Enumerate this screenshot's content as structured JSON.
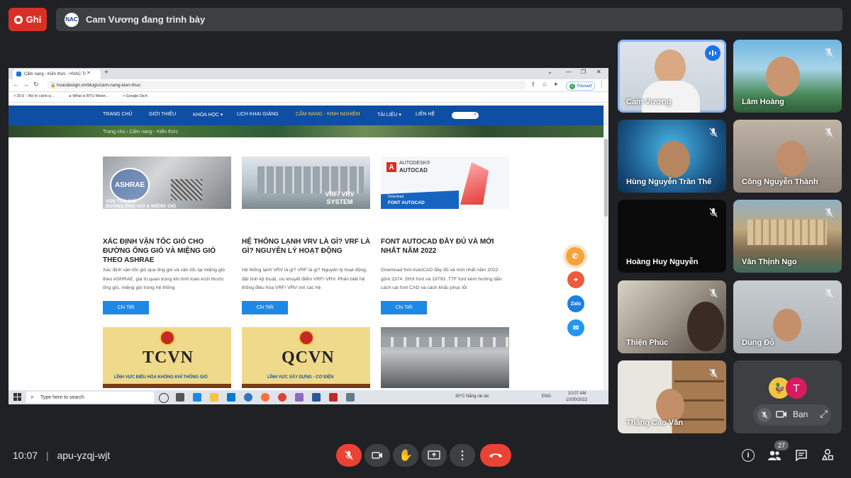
{
  "topbar": {
    "record_label": "Ghi",
    "presenter_logo": "NAC",
    "presenting_text": "Cam Vương đang trình bày"
  },
  "browser": {
    "tab_title": "Cẩm nang - Kiến thức - HVAC Tr",
    "url": "hvacdesign.vn/blogs/cam-nang-kien-thuc",
    "profile_initial": "C",
    "profile_status": "Paused",
    "bookmarks": [
      "20.6 – Bộ trì cảnh q...",
      "What is BTU Meter...",
      "Google Dịch"
    ]
  },
  "site": {
    "nav": [
      "TRANG CHỦ",
      "GIỚI THIỆU",
      "KHÓA HỌC ▾",
      "LỊCH KHAI GIẢNG",
      "CẨM NANG - KINH NGHIỆM",
      "TÀI LIỆU ▾",
      "LIÊN HỆ"
    ],
    "breadcrumb": "Trang chủ › Cẩm nang - Kiến thức",
    "cards": [
      {
        "img_logo": "ASHRAE",
        "img_caption": "VẬN TỐC GIÓ\nĐƯỜNG ỐNG GIÓ & MIỆNG GIÓ",
        "title": "XÁC ĐỊNH VẬN TỐC GIÓ CHO ĐƯỜNG ỐNG GIÓ VÀ MIỆNG GIÓ THEO ASHRAE",
        "desc": "Xác định vận tốc gió qua ống gió và vận tốc tại miệng gió theo ASHRAE, giá trị quan trọng khi tính toán kích thước ống gió, miệng gió trong hệ thống",
        "button": "Chi Tiết"
      },
      {
        "img_caption": "VRF/ VRV\nSYSTEM",
        "title": "HỆ THỐNG LẠNH VRV LÀ GÌ? VRF LÀ GÌ? NGUYÊN LÝ HOẠT ĐỘNG",
        "desc": "Hệ thống lạnh VRV là gì? VRF là gì? Nguyên lý hoạt động, đặt tính kỹ thuật, ưu khuyết điểm VRF/ VRV. Phân biệt hệ thống điều hòa VRF/ VRV với các hệ",
        "button": "Chi Tiết"
      },
      {
        "img_brand": "AUTODESK®",
        "img_product": "AUTOCAD",
        "img_small": "Download",
        "img_caption": "FONT AUTOCAD",
        "title": "FONT AUTOCAD ĐẦY ĐỦ VÀ MỚI NHẤT NĂM 2022",
        "desc": "Download font AutoCAD đầy đủ và mới nhất năm 2022 gồm 2374 .SHX font và 19793 .TTF font kèm hướng dẫn cách cài font CAD và cách khắc phục lỗi",
        "button": "Chi Tiết"
      }
    ],
    "docs": [
      {
        "code": "TCVN",
        "sub": "LĨNH VỰC ĐIỀU HÒA KHÔNG KHÍ THÔNG GIÓ"
      },
      {
        "code": "QCVN",
        "sub": "LĨNH VỰC XÂY DỰNG - CƠ ĐIỆN"
      }
    ],
    "zalo_label": "Zalo"
  },
  "taskbar": {
    "search_placeholder": "Type here to search",
    "weather": "30°C  Nắng rải rác",
    "lang": "ENG",
    "clock_time": "10:07 AM",
    "clock_date": "10/30/2022"
  },
  "participants": [
    {
      "name": "Cam Vương",
      "active_speaker": true
    },
    {
      "name": "Lâm Hoàng"
    },
    {
      "name": "Hùng Nguyễn Trần Thế"
    },
    {
      "name": "Công Nguyễn Thành"
    },
    {
      "name": "Hoàng Huy Nguyễn"
    },
    {
      "name": "Văn Thịnh Ngo"
    },
    {
      "name": "Thiện Phúc"
    },
    {
      "name": "Dung Đỗ"
    },
    {
      "name": "Thắng Cao Văn"
    }
  ],
  "self_tile": {
    "avatar_letter": "T",
    "label": "Bạn"
  },
  "bottombar": {
    "time": "10:07",
    "meeting_code": "apu-yzqj-wjt",
    "people_count": "27"
  },
  "colors": {
    "meet_bg": "#202124",
    "end_call": "#ea4335",
    "site_nav": "#0e4ea3",
    "button_blue": "#1e88e5"
  }
}
